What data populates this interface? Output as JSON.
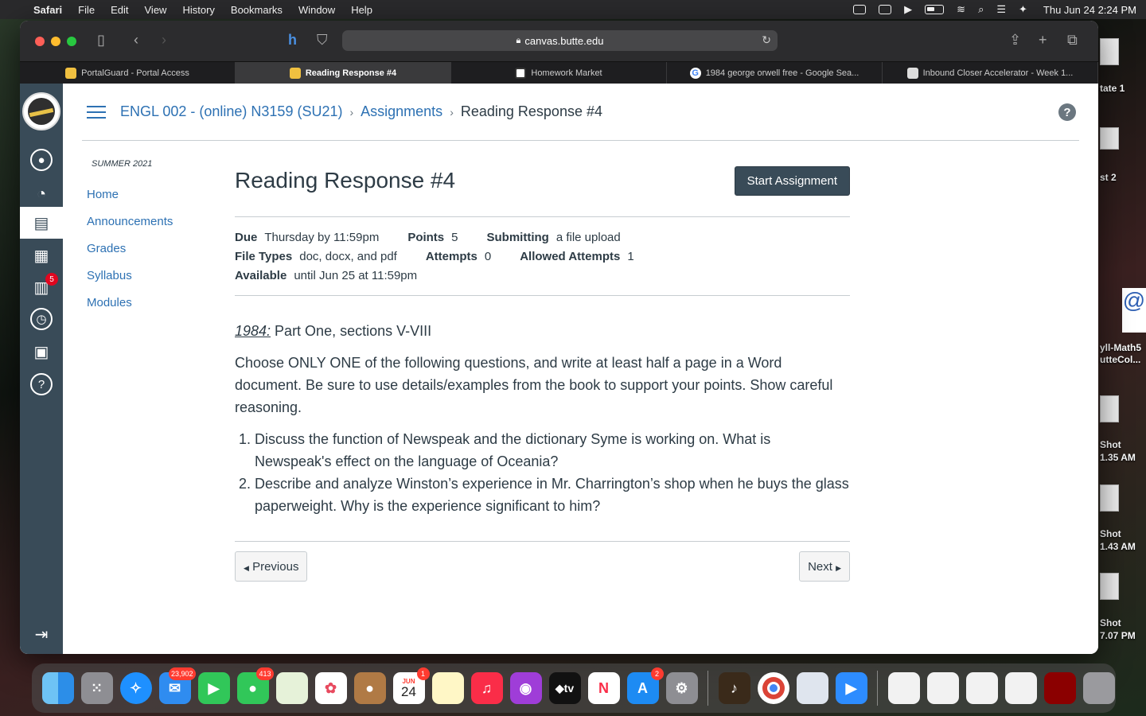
{
  "menubar": {
    "app": "Safari",
    "items": [
      "File",
      "Edit",
      "View",
      "History",
      "Bookmarks",
      "Window",
      "Help"
    ],
    "clock": "Thu Jun 24  2:24 PM"
  },
  "desktop": {
    "labels": [
      "tate 1",
      "st 2",
      "yll-Math5",
      "utteCol...",
      "Shot",
      "1.35 AM",
      "Shot",
      "1.43 AM",
      "Shot",
      "7.07 PM"
    ],
    "at_label": "@"
  },
  "browser": {
    "url": "canvas.butte.edu",
    "tabs": [
      {
        "label": "PortalGuard - Portal Access",
        "color": "#f0c040"
      },
      {
        "label": "Reading Response #4",
        "color": "#f0c040"
      },
      {
        "label": "Homework Market",
        "color": "#ffffff"
      },
      {
        "label": "1984 george orwell free - Google Sea...",
        "color": "#4285f4"
      },
      {
        "label": "Inbound Closer Accelerator - Week 1...",
        "color": "#dddddd"
      }
    ]
  },
  "globalnav": {
    "inbox_badge": "5"
  },
  "breadcrumb": {
    "course": "ENGL 002 - (online) N3159 (SU21)",
    "section": "Assignments",
    "current": "Reading Response #4"
  },
  "coursenav": {
    "term": "SUMMER 2021",
    "links": [
      "Home",
      "Announcements",
      "Grades",
      "Syllabus",
      "Modules"
    ]
  },
  "assignment": {
    "title": "Reading Response #4",
    "start_button": "Start Assignment",
    "details": {
      "due_label": "Due",
      "due": "Thursday by 11:59pm",
      "points_label": "Points",
      "points": "5",
      "submitting_label": "Submitting",
      "submitting": "a file upload",
      "filetypes_label": "File Types",
      "filetypes": "doc, docx, and pdf",
      "attempts_label": "Attempts",
      "attempts": "0",
      "allowed_label": "Allowed Attempts",
      "allowed": "1",
      "available_label": "Available",
      "available": "until Jun 25 at 11:59pm"
    },
    "book": "1984:",
    "reading": " Part One, sections V-VIII",
    "instructions": "Choose ONLY ONE of the following questions, and write at least half a  page in a Word document.  Be sure to use details/examples from the book to support your points.  Show careful reasoning.",
    "questions": [
      "Discuss the function of Newspeak and the dictionary Syme is working on. What is Newspeak's effect on the language of Oceania?",
      "Describe and analyze Winston’s experience in Mr. Charrington’s shop when he buys the glass paperweight. Why is the experience significant to him?"
    ],
    "prev": "Previous",
    "next": "Next"
  },
  "dock": {
    "mail_badge": "23,902",
    "messages_badge": "413",
    "calendar_month": "JUN",
    "calendar_day": "24",
    "calendar_badge": "1",
    "appstore_badge": "2",
    "tv_label": "tv"
  }
}
